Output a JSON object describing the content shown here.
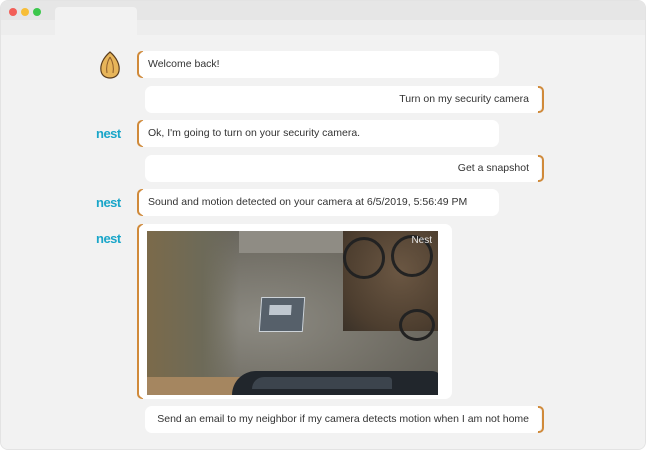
{
  "messages": {
    "m1": "Welcome back!",
    "m2": "Turn on my security camera",
    "m3": "Ok, I'm going to turn on your security camera.",
    "m4": "Get a snapshot",
    "m5": "Sound and motion detected on your camera at 6/5/2019, 5:56:49 PM",
    "m7": "Send an email to my neighbor if my camera detects motion when I am not home"
  },
  "bots": {
    "nest_label": "nest"
  },
  "snapshot": {
    "watermark": "Nest"
  },
  "icons": {
    "assistant_avatar": "almond-icon",
    "nest_logo": "nest-logo"
  },
  "colors": {
    "brace": "#d08a3a",
    "nest": "#1aa6c9",
    "bubble": "#ffffff",
    "background": "#f2f2f2"
  }
}
